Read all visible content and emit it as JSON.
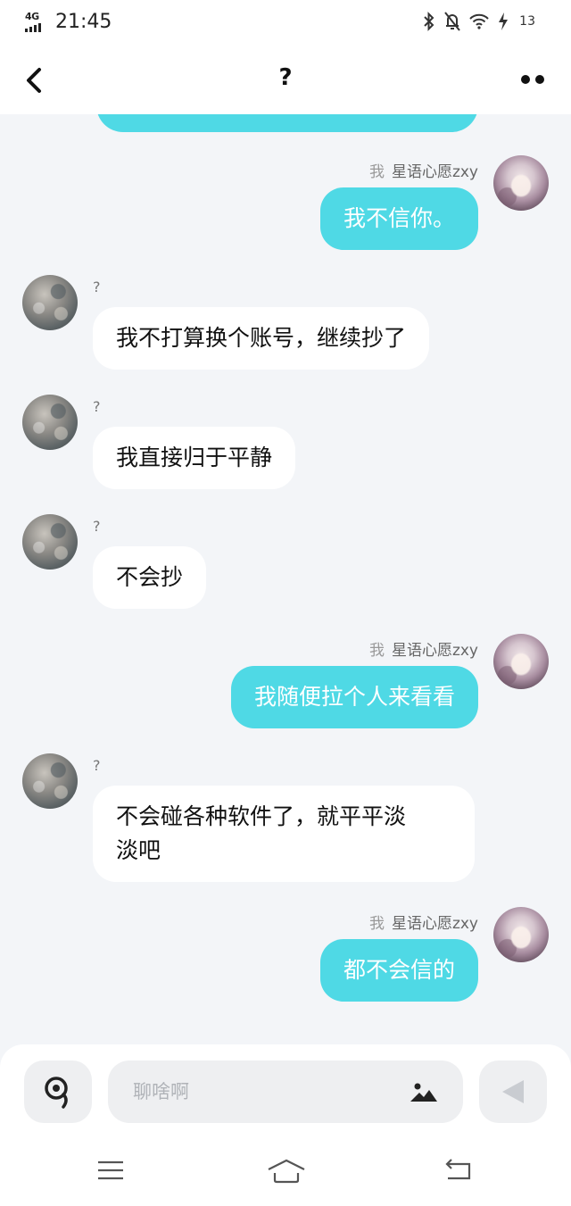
{
  "status_bar": {
    "network": "4G",
    "time": "21:45",
    "battery": "13"
  },
  "header": {
    "title": "?"
  },
  "messages": [
    {
      "sender": "me",
      "tag": "我",
      "name": "星语心愿zxy",
      "text": "我不信你。"
    },
    {
      "sender": "other",
      "name": "?",
      "text": "我不打算换个账号，继续抄了"
    },
    {
      "sender": "other",
      "name": "?",
      "text": "我直接归于平静"
    },
    {
      "sender": "other",
      "name": "?",
      "text": "不会抄"
    },
    {
      "sender": "me",
      "tag": "我",
      "name": "星语心愿zxy",
      "text": "我随便拉个人来看看"
    },
    {
      "sender": "other",
      "name": "?",
      "text": "不会碰各种软件了，就平平淡\n淡吧"
    },
    {
      "sender": "me",
      "tag": "我",
      "name": "星语心愿zxy",
      "text": "都不会信的"
    }
  ],
  "input": {
    "placeholder": "聊啥啊"
  },
  "icons": {
    "back": "chevron-left-icon",
    "more": "more-dots-icon",
    "voice": "voice-icon",
    "image": "image-icon",
    "send": "send-icon",
    "nav_menu": "menu-icon",
    "nav_home": "home-icon",
    "nav_back": "back-icon"
  },
  "colors": {
    "my_bubble": "#4fd9e5",
    "their_bubble": "#ffffff",
    "background": "#f3f5f8"
  }
}
